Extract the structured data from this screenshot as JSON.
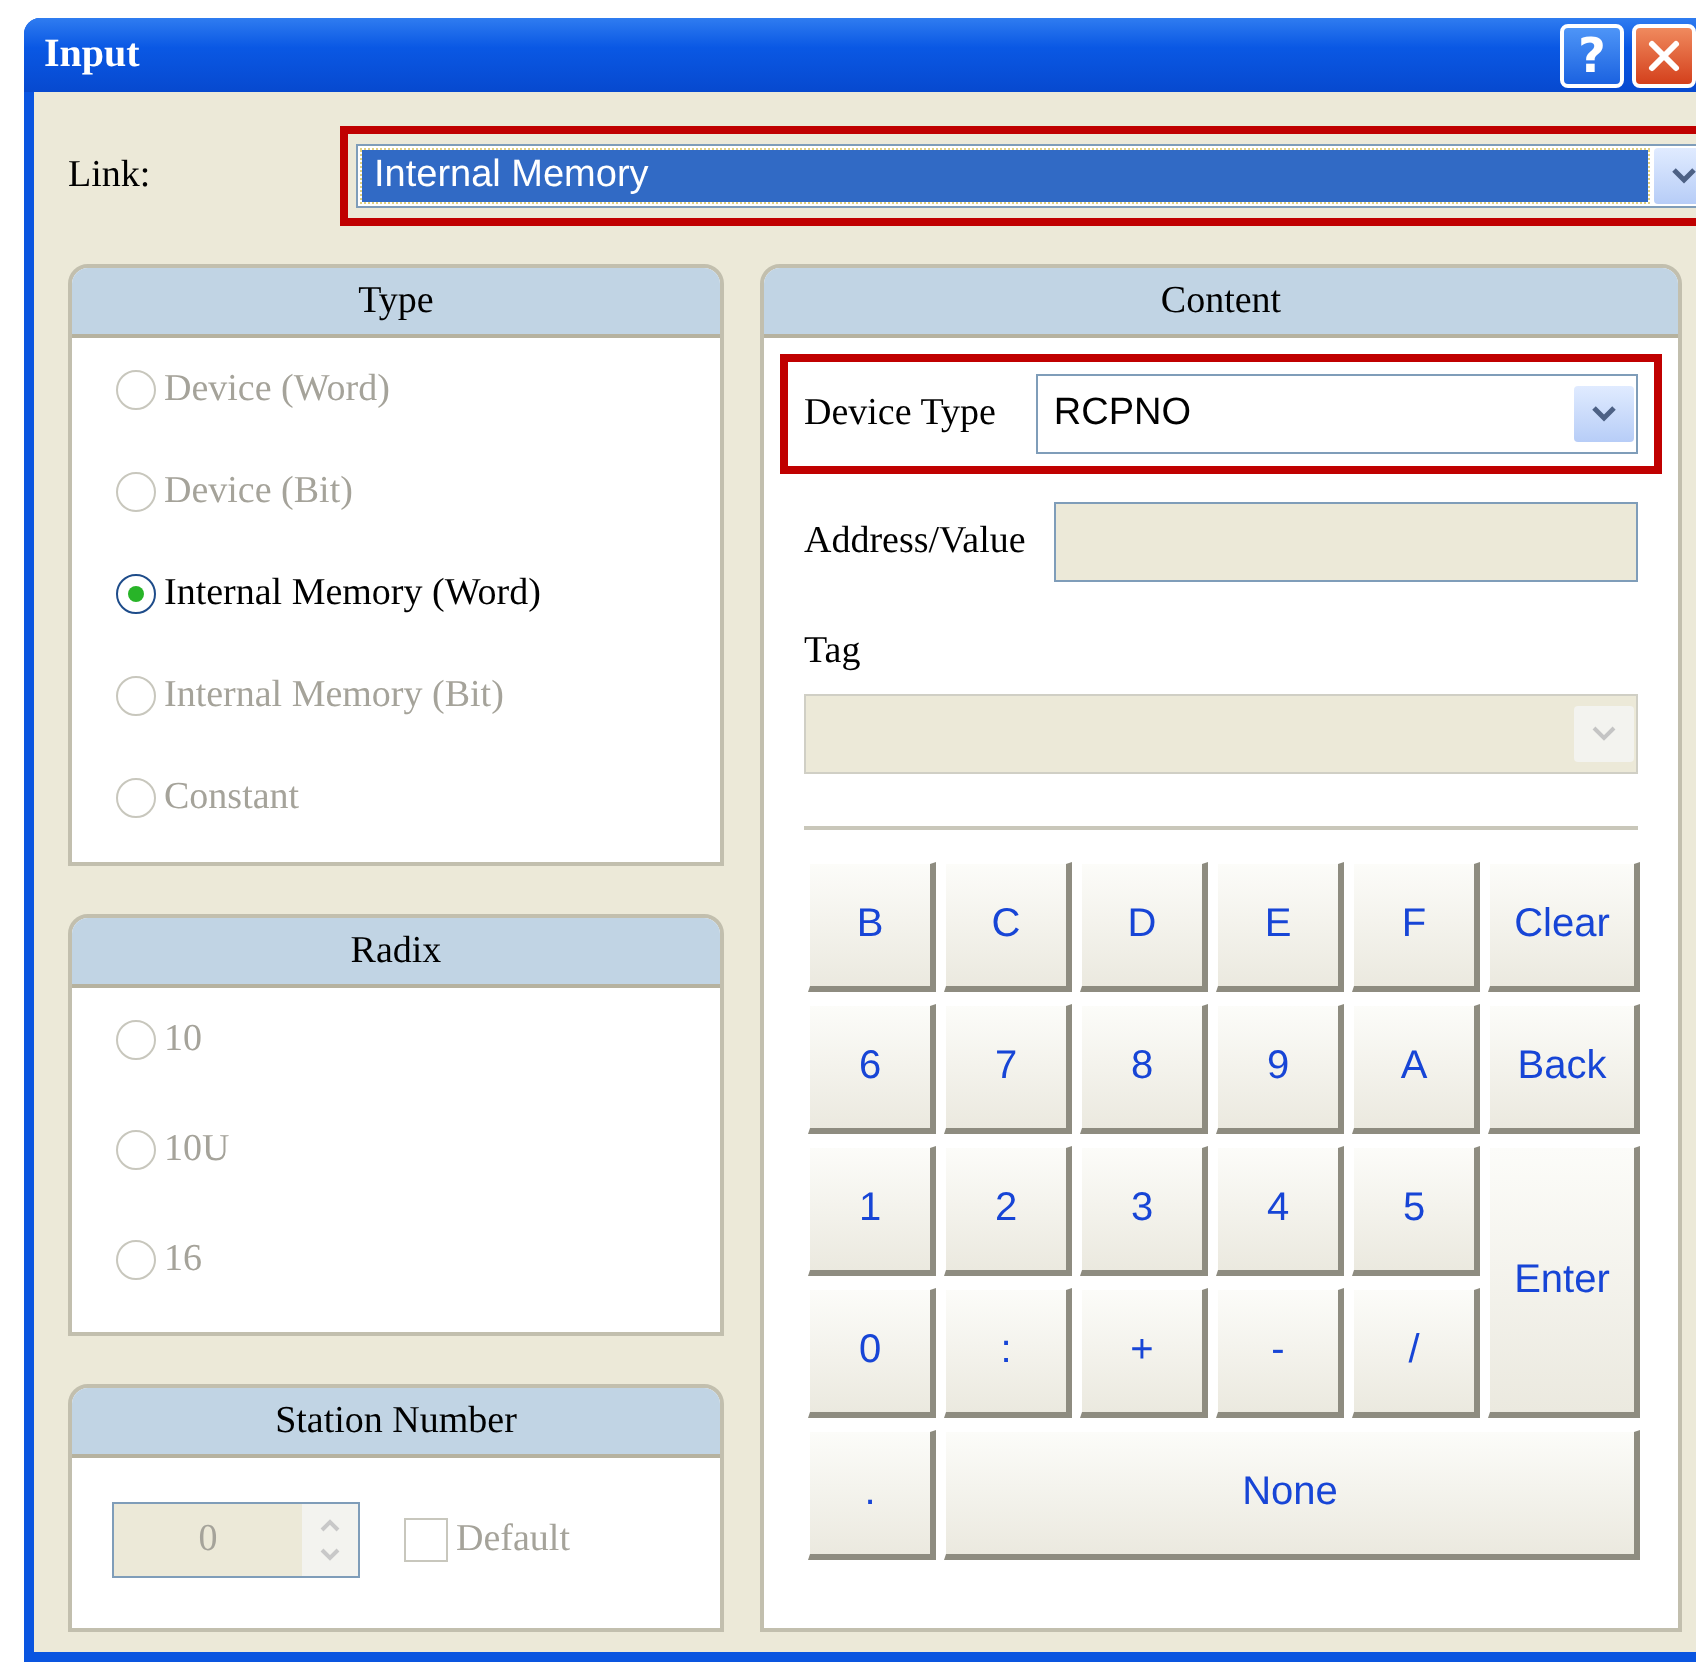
{
  "window": {
    "title": "Input",
    "help_button": "?"
  },
  "link": {
    "label": "Link:",
    "value": "Internal Memory",
    "highlighted": true
  },
  "type_panel": {
    "title": "Type",
    "options": [
      {
        "label": "Device (Word)",
        "selected": false,
        "disabled": true
      },
      {
        "label": "Device (Bit)",
        "selected": false,
        "disabled": true
      },
      {
        "label": "Internal Memory (Word)",
        "selected": true,
        "disabled": false
      },
      {
        "label": "Internal Memory (Bit)",
        "selected": false,
        "disabled": true
      },
      {
        "label": "Constant",
        "selected": false,
        "disabled": true
      }
    ]
  },
  "radix_panel": {
    "title": "Radix",
    "options": [
      {
        "label": "10",
        "selected": false,
        "disabled": true
      },
      {
        "label": "10U",
        "selected": false,
        "disabled": true
      },
      {
        "label": "16",
        "selected": false,
        "disabled": true
      }
    ]
  },
  "station_panel": {
    "title": "Station Number",
    "spinner": {
      "value": "0",
      "disabled": true
    },
    "default_checkbox": {
      "label": "Default",
      "checked": false,
      "disabled": true
    }
  },
  "content_panel": {
    "title": "Content",
    "device_type": {
      "label": "Device Type",
      "value": "RCPNO",
      "highlighted": true
    },
    "address": {
      "label": "Address/Value",
      "disabled": true
    },
    "tag": {
      "label": "Tag",
      "disabled": true
    },
    "keys": [
      {
        "label": "B",
        "kind": "key"
      },
      {
        "label": "C",
        "kind": "key"
      },
      {
        "label": "D",
        "kind": "key"
      },
      {
        "label": "E",
        "kind": "key"
      },
      {
        "label": "F",
        "kind": "key"
      },
      {
        "label": "Clear",
        "kind": "key"
      },
      {
        "label": "6",
        "kind": "key"
      },
      {
        "label": "7",
        "kind": "key"
      },
      {
        "label": "8",
        "kind": "key"
      },
      {
        "label": "9",
        "kind": "key"
      },
      {
        "label": "A",
        "kind": "key"
      },
      {
        "label": "Back",
        "kind": "key"
      },
      {
        "label": "1",
        "kind": "key"
      },
      {
        "label": "2",
        "kind": "key"
      },
      {
        "label": "3",
        "kind": "key"
      },
      {
        "label": "4",
        "kind": "key"
      },
      {
        "label": "5",
        "kind": "key"
      },
      {
        "label": "Enter",
        "kind": "tall"
      },
      {
        "label": "0",
        "kind": "key"
      },
      {
        "label": ":",
        "kind": "key"
      },
      {
        "label": "+",
        "kind": "key"
      },
      {
        "label": "-",
        "kind": "key"
      },
      {
        "label": "/",
        "kind": "key"
      },
      {
        "label": ".",
        "kind": "key"
      },
      {
        "label": "None",
        "kind": "wide"
      }
    ]
  }
}
